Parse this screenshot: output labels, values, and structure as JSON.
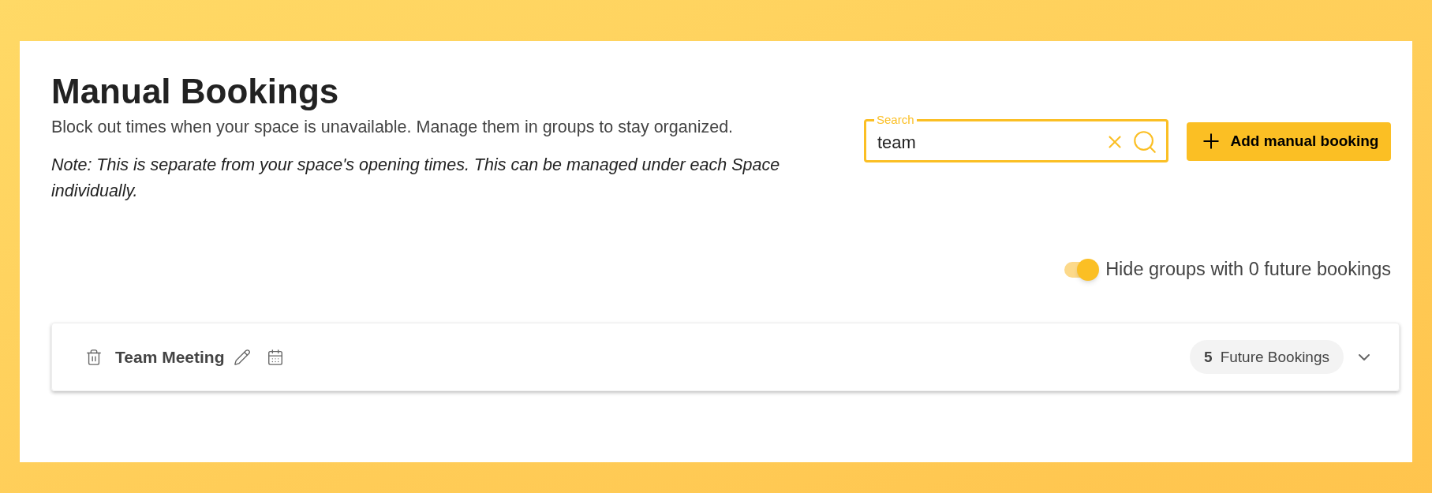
{
  "header": {
    "title": "Manual Bookings",
    "description": "Block out times when your space is unavailable. Manage them in groups to stay organized.",
    "note": "Note: This is separate from your space's opening times. This can be managed under each Space individually."
  },
  "search": {
    "label": "Search",
    "value": "team"
  },
  "add_button": {
    "label": "Add manual booking"
  },
  "hide_toggle": {
    "label": "Hide groups with 0 future bookings",
    "on": true
  },
  "groups": [
    {
      "name": "Team Meeting",
      "count": "5",
      "count_label": "Future Bookings",
      "expanded": false
    }
  ]
}
